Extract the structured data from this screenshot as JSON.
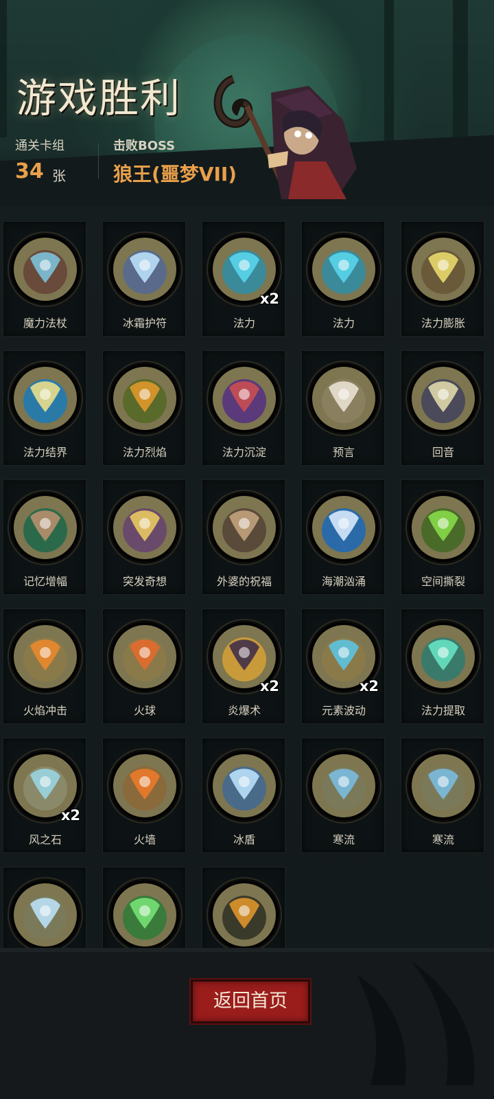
{
  "header": {
    "title": "游戏胜利",
    "deck_label": "通关卡组",
    "deck_count": "34",
    "deck_unit": "张",
    "boss_label": "击败BOSS",
    "boss_name": "狼王(噩梦VII)"
  },
  "cards": [
    {
      "name": "魔力法杖",
      "icon": "staff-icon",
      "tint": "#6a4a3a",
      "accent": "#7ec8e3",
      "mult": ""
    },
    {
      "name": "冰霜护符",
      "icon": "frost-amulet-icon",
      "tint": "#5a6a8a",
      "accent": "#bfe6ff",
      "mult": ""
    },
    {
      "name": "法力",
      "icon": "mana-orb-icon",
      "tint": "#3a8a9a",
      "accent": "#5ad8f0",
      "mult": "x2"
    },
    {
      "name": "法力",
      "icon": "mana-orb-icon",
      "tint": "#3a8a9a",
      "accent": "#5ad8f0",
      "mult": ""
    },
    {
      "name": "法力膨胀",
      "icon": "mana-surge-icon",
      "tint": "#6a5a3a",
      "accent": "#f0e070",
      "mult": ""
    },
    {
      "name": "法力结界",
      "icon": "mana-barrier-icon",
      "tint": "#2a7aa8",
      "accent": "#f4e48a",
      "mult": ""
    },
    {
      "name": "法力烈焰",
      "icon": "mana-flame-icon",
      "tint": "#5a6a2a",
      "accent": "#e89a2a",
      "mult": ""
    },
    {
      "name": "法力沉淀",
      "icon": "mana-sediment-icon",
      "tint": "#5a3a7a",
      "accent": "#d05050",
      "mult": ""
    },
    {
      "name": "预言",
      "icon": "prophecy-icon",
      "tint": "#8a8060",
      "accent": "#eee8d8",
      "mult": ""
    },
    {
      "name": "回音",
      "icon": "echo-wolf-icon",
      "tint": "#4a4a5a",
      "accent": "#e8e0b0",
      "mult": ""
    },
    {
      "name": "记忆增幅",
      "icon": "memory-brain-icon",
      "tint": "#2a6a4a",
      "accent": "#c09070",
      "mult": ""
    },
    {
      "name": "突发奇想",
      "icon": "idea-bulb-icon",
      "tint": "#6a4a6a",
      "accent": "#f0d060",
      "mult": ""
    },
    {
      "name": "外婆的祝福",
      "icon": "grandma-icon",
      "tint": "#5a4a3a",
      "accent": "#c8a880",
      "mult": ""
    },
    {
      "name": "海潮汹涌",
      "icon": "tidal-wave-icon",
      "tint": "#2a6aa8",
      "accent": "#e0f0ff",
      "mult": ""
    },
    {
      "name": "空间撕裂",
      "icon": "space-rift-icon",
      "tint": "#4a6a2a",
      "accent": "#8ae04a",
      "mult": ""
    },
    {
      "name": "火焰冲击",
      "icon": "fire-blast-icon",
      "tint": "#8a7a4a",
      "accent": "#f08a2a",
      "mult": ""
    },
    {
      "name": "火球",
      "icon": "fireball-icon",
      "tint": "#8a7a4a",
      "accent": "#e86a2a",
      "mult": ""
    },
    {
      "name": "炎爆术",
      "icon": "pyroblast-bat-icon",
      "tint": "#c89a3a",
      "accent": "#3a2a4a",
      "mult": "x2"
    },
    {
      "name": "元素波动",
      "icon": "elemental-wave-icon",
      "tint": "#8a7a4a",
      "accent": "#5ac8e8",
      "mult": "x2"
    },
    {
      "name": "法力提取",
      "icon": "mana-skull-icon",
      "tint": "#3a7a6a",
      "accent": "#6ae8c8",
      "mult": ""
    },
    {
      "name": "风之石",
      "icon": "wind-stone-icon",
      "tint": "#8a8a6a",
      "accent": "#9ad8e8",
      "mult": "x2"
    },
    {
      "name": "火墙",
      "icon": "fire-wall-icon",
      "tint": "#8a6a3a",
      "accent": "#f07a2a",
      "mult": ""
    },
    {
      "name": "冰盾",
      "icon": "ice-shield-icon",
      "tint": "#4a6a8a",
      "accent": "#bfe6ff",
      "mult": ""
    },
    {
      "name": "寒流",
      "icon": "cold-tree-icon",
      "tint": "#7a7a5a",
      "accent": "#7ac0e8",
      "mult": ""
    },
    {
      "name": "寒流",
      "icon": "cold-tree-icon",
      "tint": "#7a7a5a",
      "accent": "#7ac0e8",
      "mult": ""
    },
    {
      "name": "",
      "icon": "ice-shards-icon",
      "tint": "#7a7a5a",
      "accent": "#bfe6ff",
      "mult": ""
    },
    {
      "name": "",
      "icon": "green-vortex-icon",
      "tint": "#3a7a3a",
      "accent": "#7ae87a",
      "mult": ""
    },
    {
      "name": "",
      "icon": "dark-explosion-icon",
      "tint": "#3a3a2a",
      "accent": "#e89a2a",
      "mult": ""
    }
  ],
  "footer": {
    "back_label": "返回首页"
  }
}
